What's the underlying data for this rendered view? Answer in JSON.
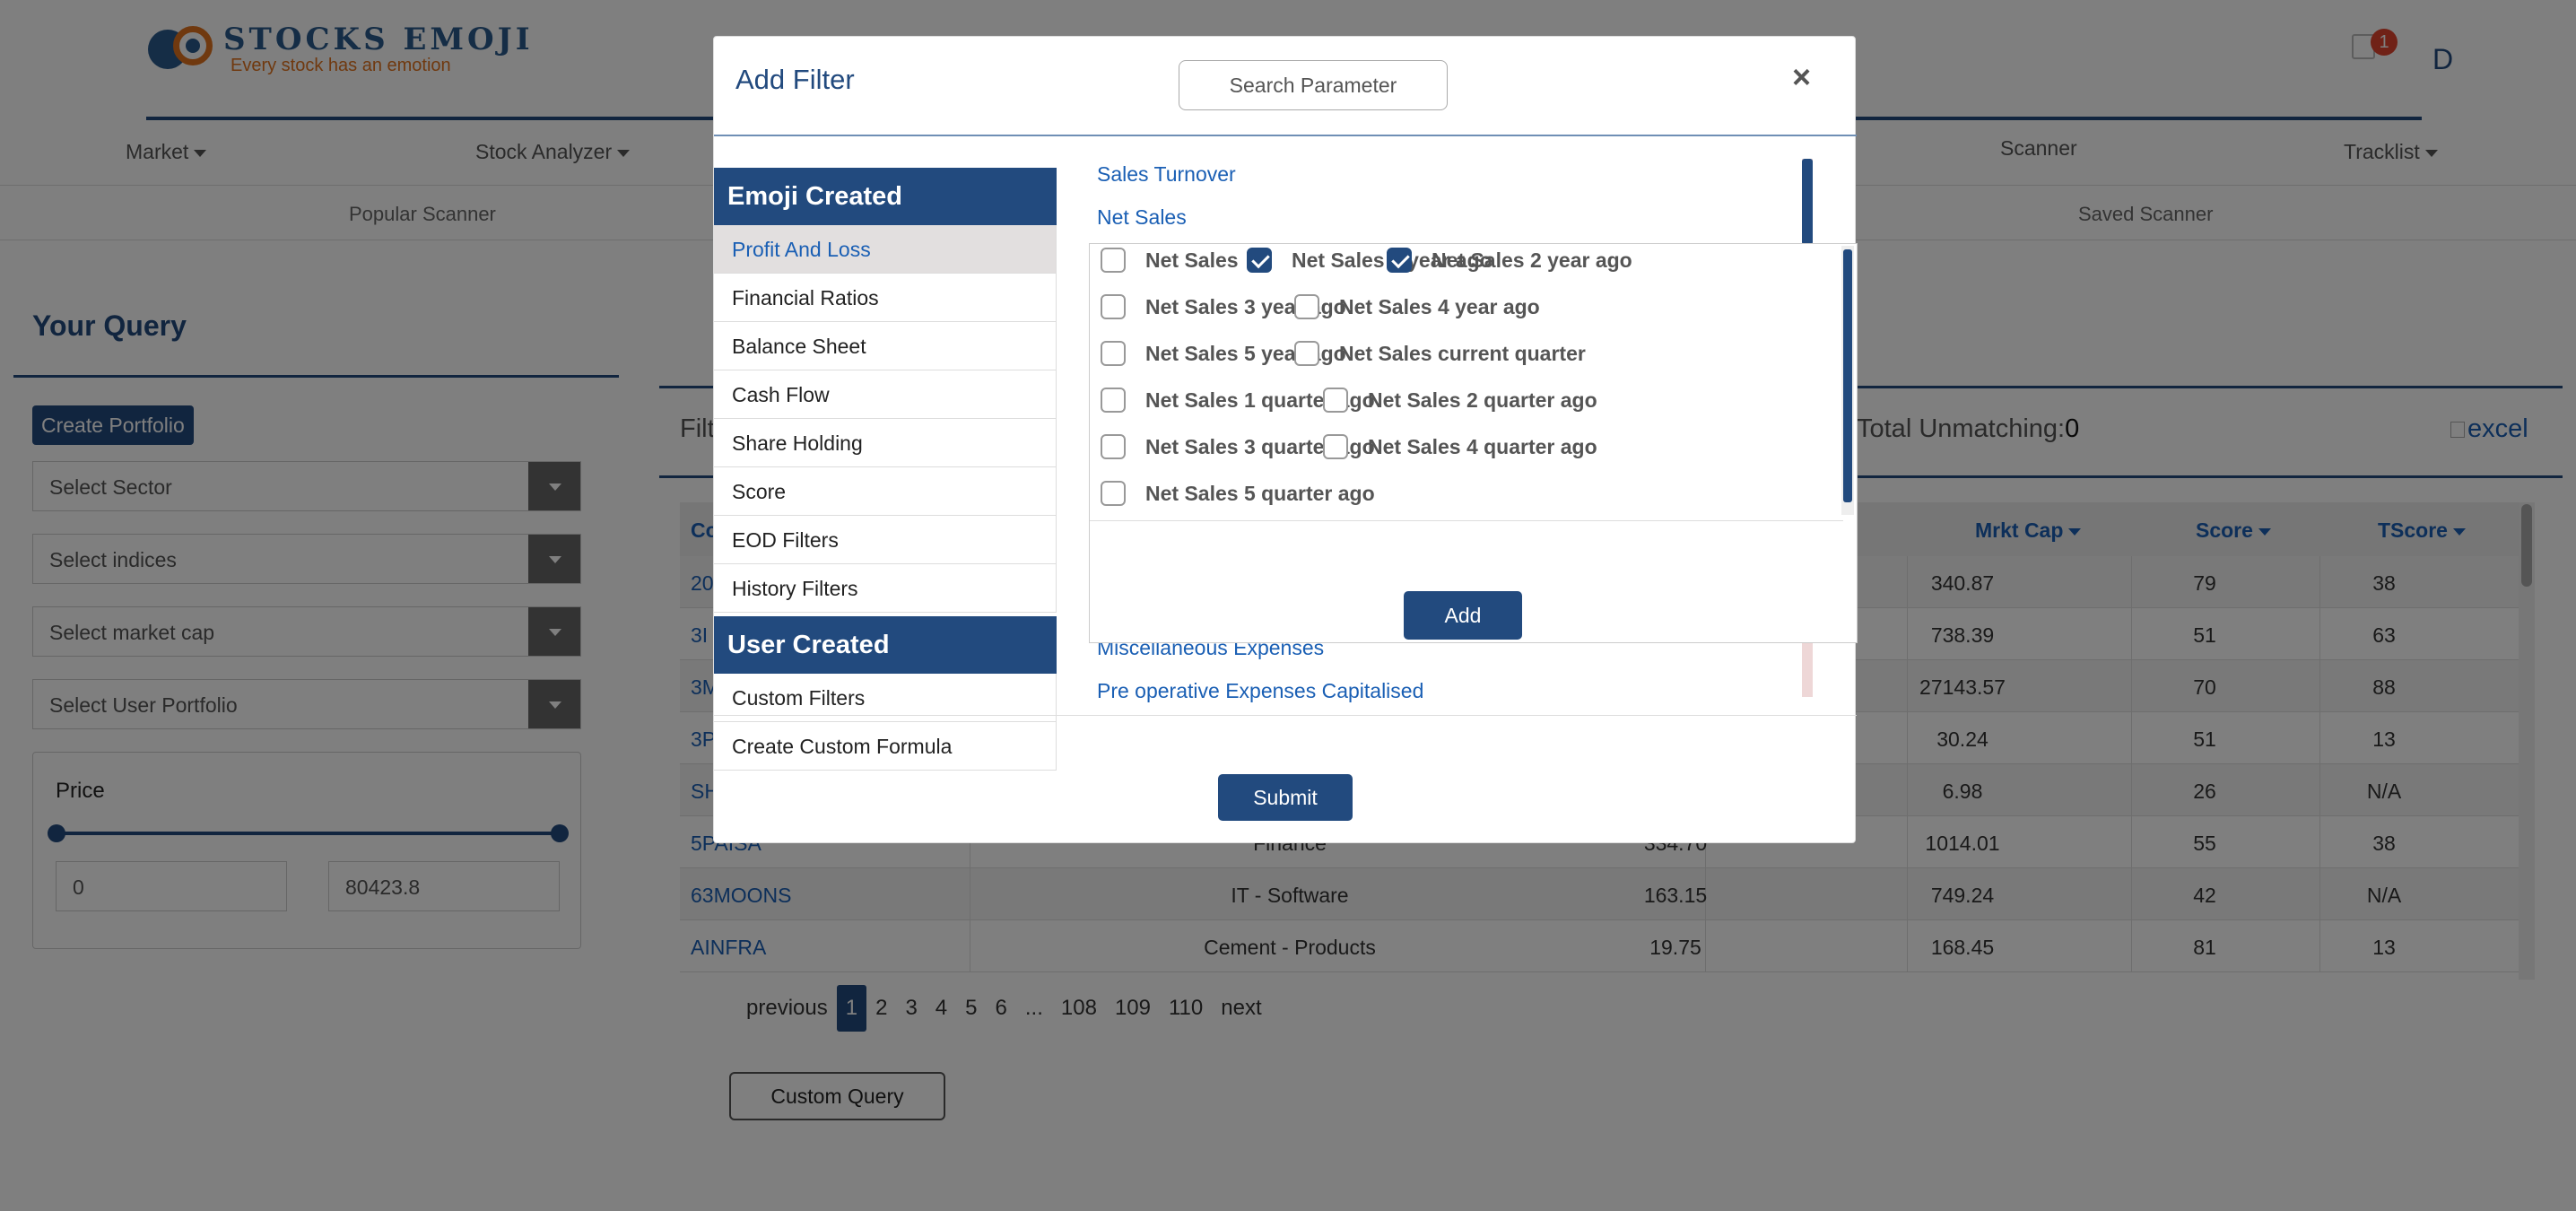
{
  "logo": {
    "title": "STOCKS EMOJI",
    "tagline": "Every stock has an emotion"
  },
  "header": {
    "notification_count": "1",
    "user_initial": "D"
  },
  "nav": {
    "market": "Market",
    "stock_analyzer": "Stock Analyzer",
    "scanner": "Scanner",
    "tracklist": "Tracklist"
  },
  "subnav": {
    "popular_scanner": "Popular Scanner",
    "saved_scanner": "Saved Scanner"
  },
  "left_panel": {
    "title": "Your Query",
    "create_portfolio": "Create Portfolio",
    "select_sector": "Select Sector",
    "select_indices": "Select indices",
    "select_market_cap": "Select market cap",
    "select_user_portfolio": "Select User Portfolio",
    "price_label": "Price",
    "price_min": "0",
    "price_max": "80423.8"
  },
  "right_panel": {
    "filter_label": "Filt",
    "total_unmatching_label": "Total Unmatching:",
    "total_unmatching_value": "0",
    "excel_alt": "excel"
  },
  "table": {
    "headers": {
      "company": "Co",
      "mrkt_cap": "Mrkt Cap",
      "score": "Score",
      "tscore": "TScore"
    },
    "rows": [
      {
        "company": "20",
        "industry": "",
        "price": "",
        "mrkt_cap": "340.87",
        "score": "79",
        "tscore": "38"
      },
      {
        "company": "3I",
        "industry": "",
        "price": "",
        "mrkt_cap": "738.39",
        "score": "51",
        "tscore": "63"
      },
      {
        "company": "3M",
        "industry": "",
        "price": "",
        "mrkt_cap": "27143.57",
        "score": "70",
        "tscore": "88"
      },
      {
        "company": "3P",
        "industry": "",
        "price": "",
        "mrkt_cap": "30.24",
        "score": "51",
        "tscore": "13"
      },
      {
        "company": "SH",
        "industry": "",
        "price": "",
        "mrkt_cap": "6.98",
        "score": "26",
        "tscore": "N/A"
      },
      {
        "company": "5PAISA",
        "industry": "Finance",
        "price": "334.70",
        "mrkt_cap": "1014.01",
        "score": "55",
        "tscore": "38"
      },
      {
        "company": "63MOONS",
        "industry": "IT - Software",
        "price": "163.15",
        "mrkt_cap": "749.24",
        "score": "42",
        "tscore": "N/A"
      },
      {
        "company": "AINFRA",
        "industry": "Cement - Products",
        "price": "19.75",
        "mrkt_cap": "168.45",
        "score": "81",
        "tscore": "13"
      }
    ]
  },
  "pagination": {
    "previous": "previous",
    "pages": [
      "1",
      "2",
      "3",
      "4",
      "5",
      "6",
      "...",
      "108",
      "109",
      "110"
    ],
    "next": "next"
  },
  "custom_query": "Custom Query",
  "modal": {
    "title": "Add Filter",
    "search_placeholder": "Search Parameter",
    "close": "×",
    "emoji_created_header": "Emoji Created",
    "emoji_created_items": [
      "Profit And Loss",
      "Financial Ratios",
      "Balance Sheet",
      "Cash Flow",
      "Share Holding",
      "Score",
      "EOD Filters",
      "History Filters"
    ],
    "user_created_header": "User Created",
    "user_created_items": [
      "Custom Filters",
      "Create Custom Formula"
    ],
    "parameters_top": [
      "Sales Turnover",
      "Net Sales"
    ],
    "parameters_bottom": [
      "Miscellaneous Expenses",
      "Pre operative Expenses Capitalised"
    ],
    "checkboxes": [
      {
        "label": "Net Sales",
        "checked": false
      },
      {
        "label": "Net Sales 1 year ago",
        "checked": true
      },
      {
        "label": "Net Sales 2 year ago",
        "checked": true
      },
      {
        "label": "Net Sales 3 year ago",
        "checked": false
      },
      {
        "label": "Net Sales 4 year ago",
        "checked": false
      },
      {
        "label": "Net Sales 5 year ago",
        "checked": false
      },
      {
        "label": "Net Sales current quarter",
        "checked": false
      },
      {
        "label": "Net Sales 1 quarter ago",
        "checked": false
      },
      {
        "label": "Net Sales 2 quarter ago",
        "checked": false
      },
      {
        "label": "Net Sales 3 quarter ago",
        "checked": false
      },
      {
        "label": "Net Sales 4 quarter ago",
        "checked": false
      },
      {
        "label": "Net Sales 5 quarter ago",
        "checked": false
      }
    ],
    "add_button": "Add",
    "submit_button": "Submit"
  },
  "colors": {
    "primary": "#224a7e",
    "link": "#1a5fb4",
    "accent": "#e0731f",
    "badge": "#e0442f"
  }
}
